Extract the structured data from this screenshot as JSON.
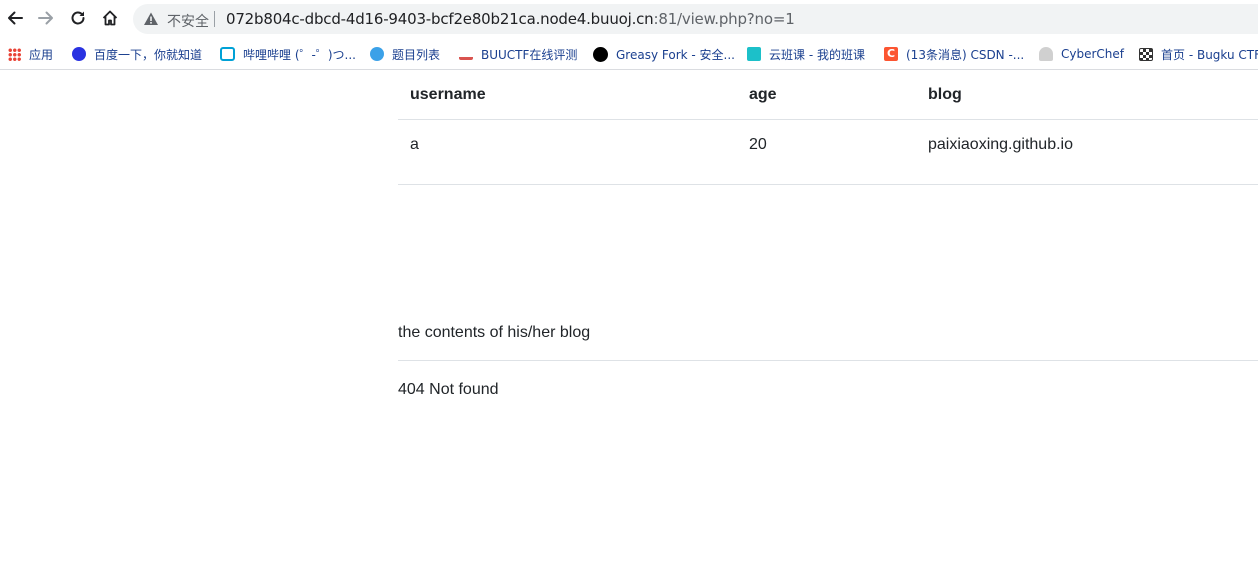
{
  "browser": {
    "not_secure_label": "不安全",
    "url_main": "072b804c-dbcd-4d16-9403-bcf2e80b21ca.node4.buuoj.cn",
    "url_rest": ":81/view.php?no=1"
  },
  "bookmarks": [
    {
      "label": "应用",
      "icon": "apps-icon",
      "color": "#e94235"
    },
    {
      "label": "百度一下，你就知道",
      "icon": "baidu-icon",
      "color": "#2932e1"
    },
    {
      "label": "哔哩哔哩 (゜-゜)つ...",
      "icon": "bilibili-icon",
      "color": "#00a1d6"
    },
    {
      "label": "题目列表",
      "icon": "list-icon",
      "color": "#3ba1e8"
    },
    {
      "label": "BUUCTF在线评测",
      "icon": "buuctf-icon",
      "color": "#d9534f"
    },
    {
      "label": "Greasy Fork - 安全...",
      "icon": "greasyfork-icon",
      "color": "#000000"
    },
    {
      "label": "云班课 - 我的班课",
      "icon": "cloud-class-icon",
      "color": "#1cc0c9"
    },
    {
      "label": "(13条消息) CSDN -...",
      "icon": "csdn-icon",
      "color": "#fc5531"
    },
    {
      "label": "CyberChef",
      "icon": "chef-hat-icon",
      "color": "#bdbdbd"
    },
    {
      "label": "首页 - Bugku CTF",
      "icon": "flag-icon",
      "color": "#333333"
    }
  ],
  "table": {
    "headers": [
      "username",
      "age",
      "blog"
    ],
    "rows": [
      [
        "a",
        "20",
        "paixiaoxing.github.io"
      ]
    ]
  },
  "blog": {
    "title": "the contents of his/her blog",
    "body": "404 Not found"
  }
}
